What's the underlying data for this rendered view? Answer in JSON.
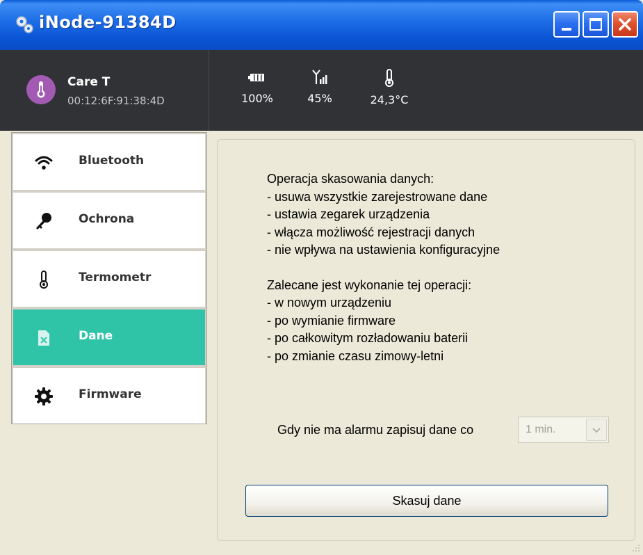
{
  "window": {
    "title": "iNode-91384D",
    "colors": {
      "titlebar": "#0b55d6",
      "accent": "#2fc4a8",
      "header_bg": "#303236"
    }
  },
  "device": {
    "name": "Care T",
    "mac": "00:12:6F:91:38:4D",
    "icon": "thermometer-icon",
    "stats": [
      {
        "icon": "battery-icon",
        "value": "100%"
      },
      {
        "icon": "signal-icon",
        "value": "45%"
      },
      {
        "icon": "thermometer-icon",
        "value": "24,3°C"
      }
    ]
  },
  "sidebar": {
    "items": [
      {
        "label": "Bluetooth",
        "icon": "wifi-icon",
        "active": false
      },
      {
        "label": "Ochrona",
        "icon": "key-icon",
        "active": false
      },
      {
        "label": "Termometr",
        "icon": "thermometer-icon",
        "active": false
      },
      {
        "label": "Dane",
        "icon": "data-file-icon",
        "active": true
      },
      {
        "label": "Firmware",
        "icon": "gear-icon",
        "active": false
      }
    ]
  },
  "main": {
    "info_lines_1": [
      "Operacja skasowania danych:",
      "- usuwa wszystkie zarejestrowane dane",
      "- ustawia zegarek urządzenia",
      "- włącza możliwość rejestracji danych",
      "- nie wpływa na ustawienia konfiguracyjne"
    ],
    "info_lines_2": [
      "Zalecane jest wykonanie tej operacji:",
      "- w nowym urządzeniu",
      "- po wymianie firmware",
      "- po całkowitym rozładowaniu baterii",
      "- po zmianie czasu zimowy-letni"
    ],
    "interval_label": "Gdy nie ma alarmu zapisuj dane co",
    "interval_value": "1 min.",
    "erase_button": "Skasuj dane"
  }
}
